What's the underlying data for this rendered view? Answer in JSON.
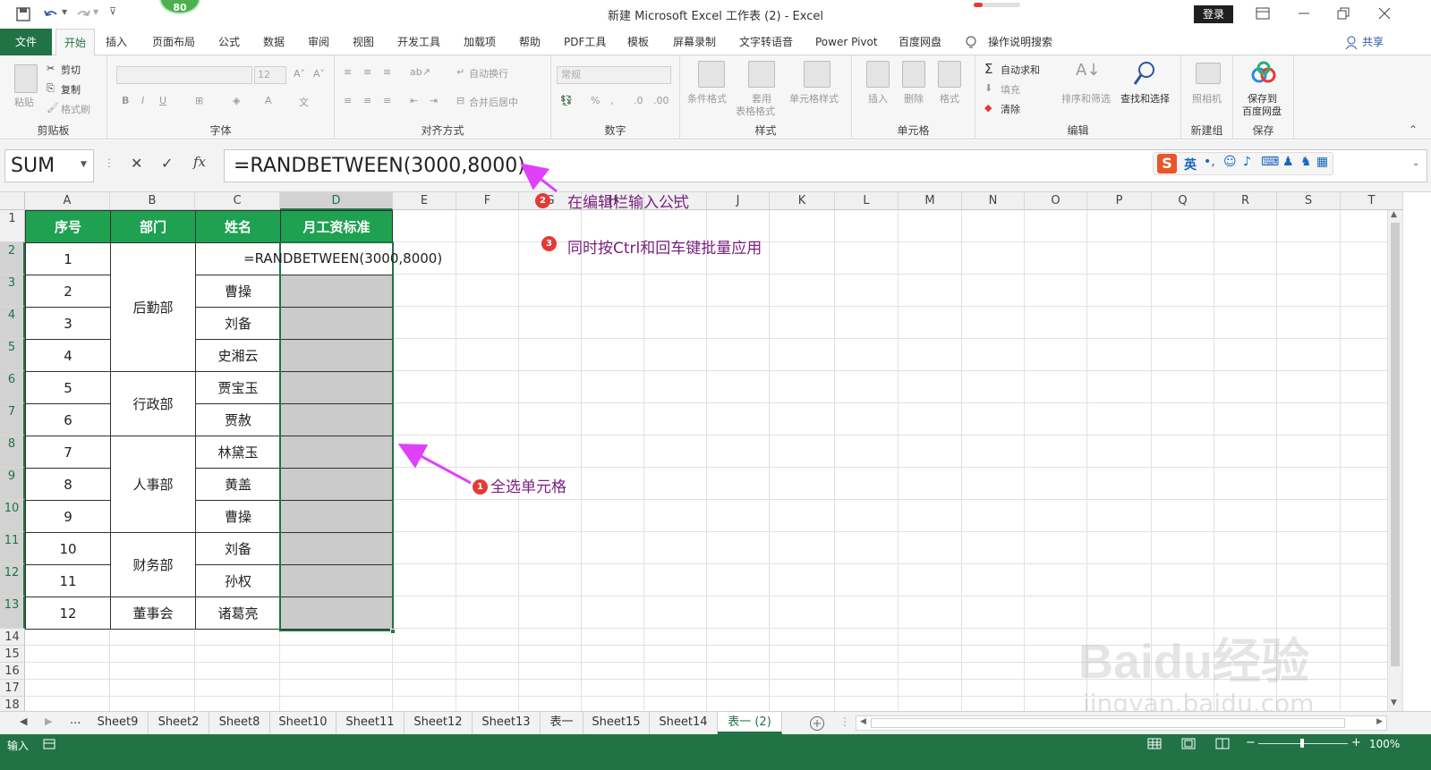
{
  "title_bar": {
    "title": "新建 Microsoft Excel 工作表 (2)  -  Excel",
    "login": "登录",
    "badge": "80"
  },
  "ribbon_tabs": [
    "文件",
    "开始",
    "插入",
    "页面布局",
    "公式",
    "数据",
    "审阅",
    "视图",
    "开发工具",
    "加载项",
    "帮助",
    "PDF工具",
    "模板",
    "屏幕录制",
    "文字转语音",
    "Power Pivot",
    "百度网盘",
    "操作说明搜索"
  ],
  "share": "共享",
  "ribbon": {
    "clipboard": {
      "label": "剪贴板",
      "paste": "粘贴",
      "cut": "剪切",
      "copy": "复制",
      "format_painter": "格式刷"
    },
    "font": {
      "label": "字体",
      "size": "12"
    },
    "alignment": {
      "label": "对齐方式",
      "wrap": "自动换行",
      "merge": "合并后居中"
    },
    "number": {
      "label": "数字",
      "format": "常规"
    },
    "styles": {
      "label": "样式",
      "conditional": "条件格式",
      "table_l1": "套用",
      "table_l2": "表格格式",
      "cell_styles": "单元格样式"
    },
    "cells": {
      "label": "单元格",
      "insert": "插入",
      "delete": "删除",
      "format": "格式"
    },
    "editing": {
      "label": "编辑",
      "autosum": "自动求和",
      "fill": "填充",
      "clear": "清除",
      "sort": "排序和筛选",
      "find": "查找和选择"
    },
    "newgroup": {
      "label": "新建组",
      "camera": "照相机"
    },
    "save": {
      "label": "保存",
      "btn_l1": "保存到",
      "btn_l2": "百度网盘"
    }
  },
  "formula_bar": {
    "name_box": "SUM",
    "formula": "=RANDBETWEEN(3000,8000)",
    "ime": "英"
  },
  "columns": [
    "A",
    "B",
    "C",
    "D",
    "E",
    "F",
    "G",
    "H",
    "I",
    "J",
    "K",
    "L",
    "M",
    "N",
    "O",
    "P",
    "Q",
    "R",
    "S",
    "T"
  ],
  "rows": [
    "1",
    "2",
    "3",
    "4",
    "5",
    "6",
    "7",
    "8",
    "9",
    "10",
    "11",
    "12",
    "13",
    "14",
    "15",
    "16",
    "17",
    "18"
  ],
  "table": {
    "headers": [
      "序号",
      "部门",
      "姓名",
      "月工资标准"
    ],
    "seq": [
      "1",
      "2",
      "3",
      "4",
      "5",
      "6",
      "7",
      "8",
      "9",
      "10",
      "11",
      "12"
    ],
    "depts": [
      "后勤部",
      "行政部",
      "人事部",
      "财务部",
      "董事会"
    ],
    "names": [
      "曹操",
      "刘备",
      "史湘云",
      "贾宝玉",
      "贾赦",
      "林黛玉",
      "黄盖",
      "曹操",
      "刘备",
      "孙权",
      "诸葛亮"
    ],
    "edit_formula": "=RANDBETWEEN(3000,8000)"
  },
  "annotations": {
    "a1": {
      "num": "1",
      "text": "全选单元格"
    },
    "a2": {
      "num": "2",
      "text": "在编辑栏输入公式"
    },
    "a3": {
      "num": "3",
      "text": "同时按Ctrl和回车键批量应用"
    }
  },
  "sheet_tabs": [
    "Sheet9",
    "Sheet2",
    "Sheet8",
    "Sheet10",
    "Sheet11",
    "Sheet12",
    "Sheet13",
    "表一",
    "Sheet15",
    "Sheet14",
    "表一 (2)"
  ],
  "status": {
    "mode": "输入",
    "zoom": "100%"
  },
  "watermark": {
    "line1": "Baidu经验",
    "line2": "jingyan.baidu.com"
  },
  "colors": {
    "excel_green": "#217346",
    "header_green": "#1ea150",
    "annotation": "#7a2080",
    "arrow": "#e040fb"
  }
}
